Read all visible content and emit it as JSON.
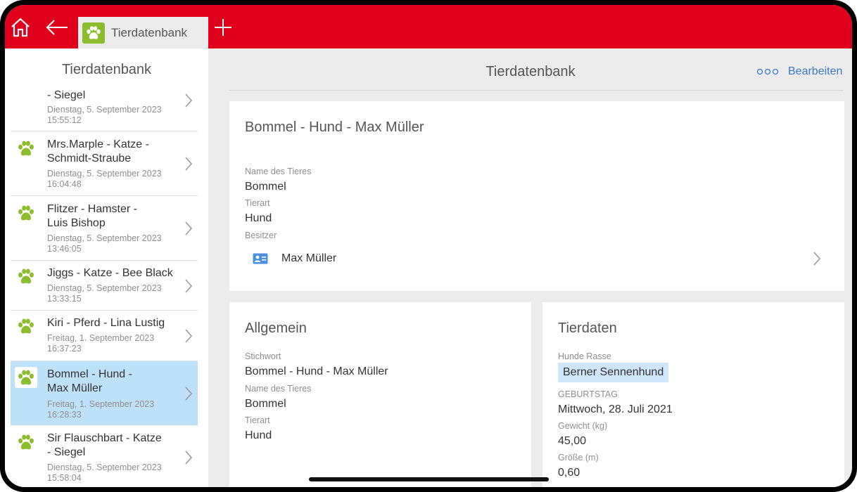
{
  "topbar": {
    "tab_label": "Tierdatenbank",
    "icons": [
      "home-icon",
      "back-arrow-icon",
      "paw-icon",
      "plus-icon"
    ],
    "accent_color": "#e0001b",
    "paw_color": "#8cbd2c"
  },
  "sidebar": {
    "title": "Tierdatenbank",
    "items": [
      {
        "name": "- Siegel",
        "date": "Dienstag, 5. September 2023",
        "time": "15:55:12"
      },
      {
        "name": "Mrs.Marple - Katze -\nSchmidt-Straube",
        "date": "Dienstag, 5. September 2023",
        "time": "16:04:48"
      },
      {
        "name": "Flitzer - Hamster -\nLuis Bishop",
        "date": "Dienstag, 5. September 2023",
        "time": "13:46:05"
      },
      {
        "name": "Jiggs - Katze - Bee Black",
        "date": "Dienstag, 5. September 2023",
        "time": "13:33:15"
      },
      {
        "name": "Kiri - Pferd - Lina Lustig",
        "date": "Freitag, 1. September 2023",
        "time": "16:37:23"
      },
      {
        "name": "Bommel - Hund -\nMax Müller",
        "date": "Freitag, 1. September 2023",
        "time": "16:28:33",
        "selected": true
      },
      {
        "name": "Sir Flauschbart - Katze\n- Siegel",
        "date": "Dienstag, 5. September 2023",
        "time": "15:58:04"
      }
    ]
  },
  "main": {
    "title": "Tierdatenbank",
    "edit_label": "Bearbeiten",
    "header_card": {
      "title": "Bommel - Hund - Max Müller",
      "name_label": "Name des Tieres",
      "name_value": "Bommel",
      "species_label": "Tierart",
      "species_value": "Hund",
      "owner_label": "Besitzer",
      "owner_value": "Max Müller"
    },
    "general_card": {
      "title": "Allgemein",
      "keyword_label": "Stichwort",
      "keyword_value": "Bommel - Hund - Max Müller",
      "name_label": "Name des Tieres",
      "name_value": "Bommel",
      "species_label": "Tierart",
      "species_value": "Hund"
    },
    "data_card": {
      "title": "Tierdaten",
      "breed_label": "Hunde Rasse",
      "breed_value": "Berner Sennenhund",
      "birthday_label": "GEBURTSTAG",
      "birthday_value": "Mittwoch, 28. Juli 2021",
      "weight_label": "Gewicht (kg)",
      "weight_value": "45,00",
      "height_label": "Größe (m)",
      "height_value": "0,60"
    }
  }
}
